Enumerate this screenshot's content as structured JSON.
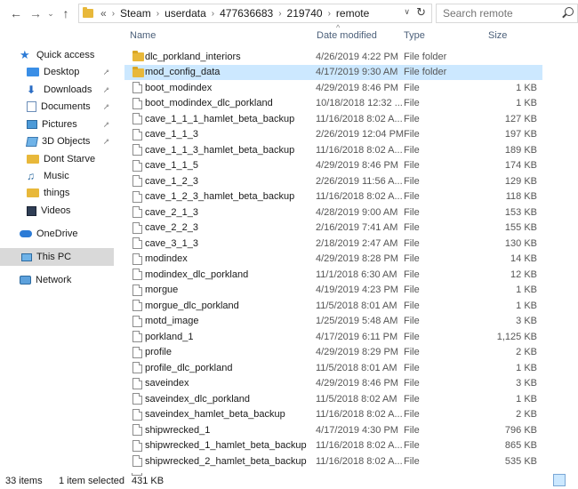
{
  "nav": {
    "back_icon": "←",
    "forward_icon": "→",
    "recent_icon": "⌄",
    "up_icon": "↑"
  },
  "address": {
    "overflow": "«",
    "crumbs": [
      "Steam",
      "userdata",
      "477636683",
      "219740",
      "remote"
    ],
    "separator": "›",
    "dropdown_icon": "∨",
    "refresh_icon": "↻"
  },
  "search": {
    "placeholder": "Search remote"
  },
  "sidebar": {
    "items": [
      {
        "label": "Quick access",
        "icon": "star-icon",
        "pinned": false
      },
      {
        "label": "Desktop",
        "icon": "desktop-icon",
        "pinned": true
      },
      {
        "label": "Downloads",
        "icon": "download-icon",
        "pinned": true
      },
      {
        "label": "Documents",
        "icon": "document-icon",
        "pinned": true
      },
      {
        "label": "Pictures",
        "icon": "pictures-icon",
        "pinned": true
      },
      {
        "label": "3D Objects",
        "icon": "3d-objects-icon",
        "pinned": true
      },
      {
        "label": "Dont Starve",
        "icon": "folder-icon",
        "pinned": false
      },
      {
        "label": "Music",
        "icon": "music-icon",
        "pinned": false
      },
      {
        "label": "things",
        "icon": "folder-icon",
        "pinned": false
      },
      {
        "label": "Videos",
        "icon": "video-icon",
        "pinned": false
      },
      {
        "label": "OneDrive",
        "icon": "cloud-icon",
        "pinned": false
      },
      {
        "label": "This PC",
        "icon": "computer-icon",
        "pinned": false,
        "selected": true
      },
      {
        "label": "Network",
        "icon": "network-icon",
        "pinned": false
      }
    ],
    "pin_glyph": "📌"
  },
  "columns": {
    "name": "Name",
    "date": "Date modified",
    "type": "Type",
    "size": "Size",
    "sort_glyph": "^"
  },
  "files": [
    {
      "name": "dlc_porkland_interiors",
      "date": "4/26/2019 4:22 PM",
      "type": "File folder",
      "size": "",
      "kind": "folder"
    },
    {
      "name": "mod_config_data",
      "date": "4/17/2019 9:30 AM",
      "type": "File folder",
      "size": "",
      "kind": "folder",
      "selected": true
    },
    {
      "name": "boot_modindex",
      "date": "4/29/2019 8:46 PM",
      "type": "File",
      "size": "1 KB",
      "kind": "file"
    },
    {
      "name": "boot_modindex_dlc_porkland",
      "date": "10/18/2018 12:32 ...",
      "type": "File",
      "size": "1 KB",
      "kind": "file"
    },
    {
      "name": "cave_1_1_1_hamlet_beta_backup",
      "date": "11/16/2018 8:02 A...",
      "type": "File",
      "size": "127 KB",
      "kind": "file"
    },
    {
      "name": "cave_1_1_3",
      "date": "2/26/2019 12:04 PM",
      "type": "File",
      "size": "197 KB",
      "kind": "file"
    },
    {
      "name": "cave_1_1_3_hamlet_beta_backup",
      "date": "11/16/2018 8:02 A...",
      "type": "File",
      "size": "189 KB",
      "kind": "file"
    },
    {
      "name": "cave_1_1_5",
      "date": "4/29/2019 8:46 PM",
      "type": "File",
      "size": "174 KB",
      "kind": "file"
    },
    {
      "name": "cave_1_2_3",
      "date": "2/26/2019 11:56 A...",
      "type": "File",
      "size": "129 KB",
      "kind": "file"
    },
    {
      "name": "cave_1_2_3_hamlet_beta_backup",
      "date": "11/16/2018 8:02 A...",
      "type": "File",
      "size": "118 KB",
      "kind": "file"
    },
    {
      "name": "cave_2_1_3",
      "date": "4/28/2019 9:00 AM",
      "type": "File",
      "size": "153 KB",
      "kind": "file"
    },
    {
      "name": "cave_2_2_3",
      "date": "2/16/2019 7:41 AM",
      "type": "File",
      "size": "155 KB",
      "kind": "file"
    },
    {
      "name": "cave_3_1_3",
      "date": "2/18/2019 2:47 AM",
      "type": "File",
      "size": "130 KB",
      "kind": "file"
    },
    {
      "name": "modindex",
      "date": "4/29/2019 8:28 PM",
      "type": "File",
      "size": "14 KB",
      "kind": "file"
    },
    {
      "name": "modindex_dlc_porkland",
      "date": "11/1/2018 6:30 AM",
      "type": "File",
      "size": "12 KB",
      "kind": "file"
    },
    {
      "name": "morgue",
      "date": "4/19/2019 4:23 PM",
      "type": "File",
      "size": "1 KB",
      "kind": "file"
    },
    {
      "name": "morgue_dlc_porkland",
      "date": "11/5/2018 8:01 AM",
      "type": "File",
      "size": "1 KB",
      "kind": "file"
    },
    {
      "name": "motd_image",
      "date": "1/25/2019 5:48 AM",
      "type": "File",
      "size": "3 KB",
      "kind": "file"
    },
    {
      "name": "porkland_1",
      "date": "4/17/2019 6:11 PM",
      "type": "File",
      "size": "1,125 KB",
      "kind": "file"
    },
    {
      "name": "profile",
      "date": "4/29/2019 8:29 PM",
      "type": "File",
      "size": "2 KB",
      "kind": "file"
    },
    {
      "name": "profile_dlc_porkland",
      "date": "11/5/2018 8:01 AM",
      "type": "File",
      "size": "1 KB",
      "kind": "file"
    },
    {
      "name": "saveindex",
      "date": "4/29/2019 8:46 PM",
      "type": "File",
      "size": "3 KB",
      "kind": "file"
    },
    {
      "name": "saveindex_dlc_porkland",
      "date": "11/5/2018 8:02 AM",
      "type": "File",
      "size": "1 KB",
      "kind": "file"
    },
    {
      "name": "saveindex_hamlet_beta_backup",
      "date": "11/16/2018 8:02 A...",
      "type": "File",
      "size": "2 KB",
      "kind": "file"
    },
    {
      "name": "shipwrecked_1",
      "date": "4/17/2019 4:30 PM",
      "type": "File",
      "size": "796 KB",
      "kind": "file"
    },
    {
      "name": "shipwrecked_1_hamlet_beta_backup",
      "date": "11/16/2018 8:02 A...",
      "type": "File",
      "size": "865 KB",
      "kind": "file"
    },
    {
      "name": "shipwrecked_2_hamlet_beta_backup",
      "date": "11/16/2018 8:02 A...",
      "type": "File",
      "size": "535 KB",
      "kind": "file"
    }
  ],
  "status": {
    "items": "33 items",
    "selection": "1 item selected",
    "size": "431 KB"
  }
}
